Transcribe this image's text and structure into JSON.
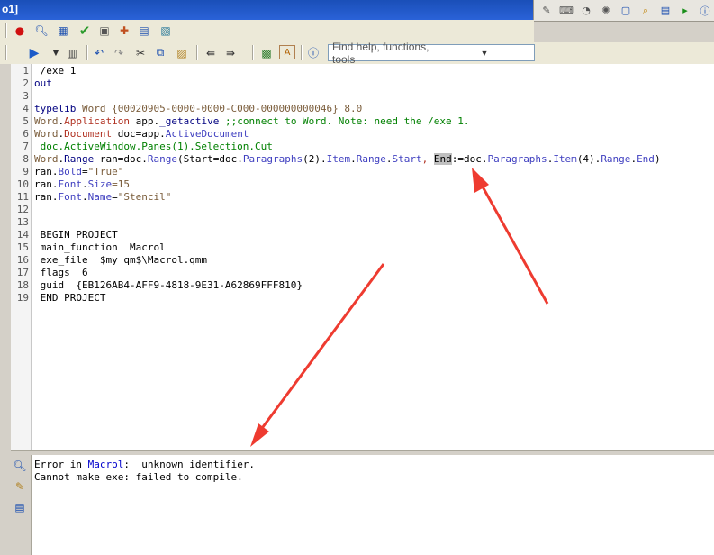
{
  "window": {
    "title_fragment": "o1]"
  },
  "right_toolbar": {
    "icons": [
      "pen-ruler-icon",
      "keyboard-icon",
      "mouse-icon",
      "spinner-icon",
      "window-icon",
      "search-window-icon",
      "form-icon",
      "run-step-icon",
      "info-icon"
    ]
  },
  "toolbar1": {
    "icons": [
      "record-icon",
      "find-icon",
      "calculator-icon",
      "check-icon",
      "exe-icon",
      "puzzle-icon",
      "form-icon",
      "clipboard-icon"
    ]
  },
  "toolbar2": {
    "search_placeholder": "Find help, functions, tools",
    "icons": [
      "run-icon",
      "dropdown-arrow-icon",
      "grid-icon",
      "undo-icon",
      "redo-icon",
      "cut-icon",
      "copy-icon",
      "paste-icon",
      "back-icon",
      "forward-icon",
      "toggle-icon",
      "text-icon",
      "help-icon"
    ]
  },
  "editor": {
    "line_numbers": [
      "1",
      "2",
      "3",
      "4",
      "5",
      "6",
      "7",
      "8",
      "9",
      "10",
      "11",
      "12",
      "13",
      "14",
      "15",
      "16",
      "17",
      "18",
      "19"
    ],
    "lines": [
      [
        {
          "t": " /exe 1",
          "c": ""
        }
      ],
      [
        {
          "t": "out",
          "c": "kw"
        }
      ],
      [
        {
          "t": "",
          "c": ""
        }
      ],
      [
        {
          "t": "typelib",
          "c": "kw"
        },
        {
          "t": " Word ",
          "c": "nm"
        },
        {
          "t": "{00020905-0000-0000-C000-000000000046} 8.0",
          "c": "nm"
        }
      ],
      [
        {
          "t": "Word",
          "c": "nm"
        },
        {
          "t": ".",
          "c": ""
        },
        {
          "t": "Application",
          "c": "red"
        },
        {
          "t": " app.",
          "c": ""
        },
        {
          "t": "_getactive",
          "c": "kw"
        },
        {
          "t": " ;;connect to Word. Note: need the /exe 1.",
          "c": "gr"
        }
      ],
      [
        {
          "t": "Word",
          "c": "nm"
        },
        {
          "t": ".",
          "c": ""
        },
        {
          "t": "Document",
          "c": "red"
        },
        {
          "t": " doc=app.",
          "c": ""
        },
        {
          "t": "ActiveDocument",
          "c": "mem"
        }
      ],
      [
        {
          "t": " doc.ActiveWindow.Panes(1).Selection.Cut",
          "c": "gr"
        }
      ],
      [
        {
          "t": "Word",
          "c": "nm"
        },
        {
          "t": ".",
          "c": ""
        },
        {
          "t": "Range",
          "c": "kw"
        },
        {
          "t": " ran=doc.",
          "c": ""
        },
        {
          "t": "Range",
          "c": "mem"
        },
        {
          "t": "(Start=doc.",
          "c": ""
        },
        {
          "t": "Paragraphs",
          "c": "mem"
        },
        {
          "t": "(2).",
          "c": ""
        },
        {
          "t": "Item",
          "c": "mem"
        },
        {
          "t": ".",
          "c": ""
        },
        {
          "t": "Range",
          "c": "mem"
        },
        {
          "t": ".",
          "c": ""
        },
        {
          "t": "Start",
          "c": "mem"
        },
        {
          "t": ", ",
          "c": "red"
        },
        {
          "t": "End",
          "c": "hl"
        },
        {
          "t": ":=doc.",
          "c": ""
        },
        {
          "t": "Paragraphs",
          "c": "mem"
        },
        {
          "t": ".",
          "c": ""
        },
        {
          "t": "Item",
          "c": "mem"
        },
        {
          "t": "(4).",
          "c": ""
        },
        {
          "t": "Range",
          "c": "mem"
        },
        {
          "t": ".",
          "c": ""
        },
        {
          "t": "End",
          "c": "mem"
        },
        {
          "t": ")",
          "c": ""
        }
      ],
      [
        {
          "t": "ran.",
          "c": ""
        },
        {
          "t": "Bold",
          "c": "mem"
        },
        {
          "t": "=",
          "c": ""
        },
        {
          "t": "\"True\"",
          "c": "nm"
        }
      ],
      [
        {
          "t": "ran.",
          "c": ""
        },
        {
          "t": "Font",
          "c": "mem"
        },
        {
          "t": ".",
          "c": ""
        },
        {
          "t": "Size",
          "c": "mem"
        },
        {
          "t": "=15",
          "c": "nm"
        }
      ],
      [
        {
          "t": "ran.",
          "c": ""
        },
        {
          "t": "Font",
          "c": "mem"
        },
        {
          "t": ".",
          "c": ""
        },
        {
          "t": "Name",
          "c": "mem"
        },
        {
          "t": "=",
          "c": ""
        },
        {
          "t": "\"Stencil\"",
          "c": "nm"
        }
      ],
      [
        {
          "t": "",
          "c": ""
        }
      ],
      [
        {
          "t": "",
          "c": ""
        }
      ],
      [
        {
          "t": " BEGIN PROJECT",
          "c": ""
        }
      ],
      [
        {
          "t": " main_function  Macrol",
          "c": ""
        }
      ],
      [
        {
          "t": " exe_file  $my qm$\\Macrol.qmm",
          "c": ""
        }
      ],
      [
        {
          "t": " flags  6",
          "c": ""
        }
      ],
      [
        {
          "t": " guid  {EB126AB4-AFF9-4818-9E31-A62869FFF810}",
          "c": ""
        }
      ],
      [
        {
          "t": " END PROJECT",
          "c": ""
        }
      ]
    ]
  },
  "output": {
    "line1_prefix": "Error in ",
    "line1_link": "Macrol",
    "line1_suffix": ":  unknown identifier.",
    "line2": "Cannot make exe: failed to compile.",
    "icons": [
      "find-icon",
      "edit-note-icon",
      "list-help-icon"
    ]
  },
  "annotations": {
    "arrow_color": "#ee3b30"
  }
}
